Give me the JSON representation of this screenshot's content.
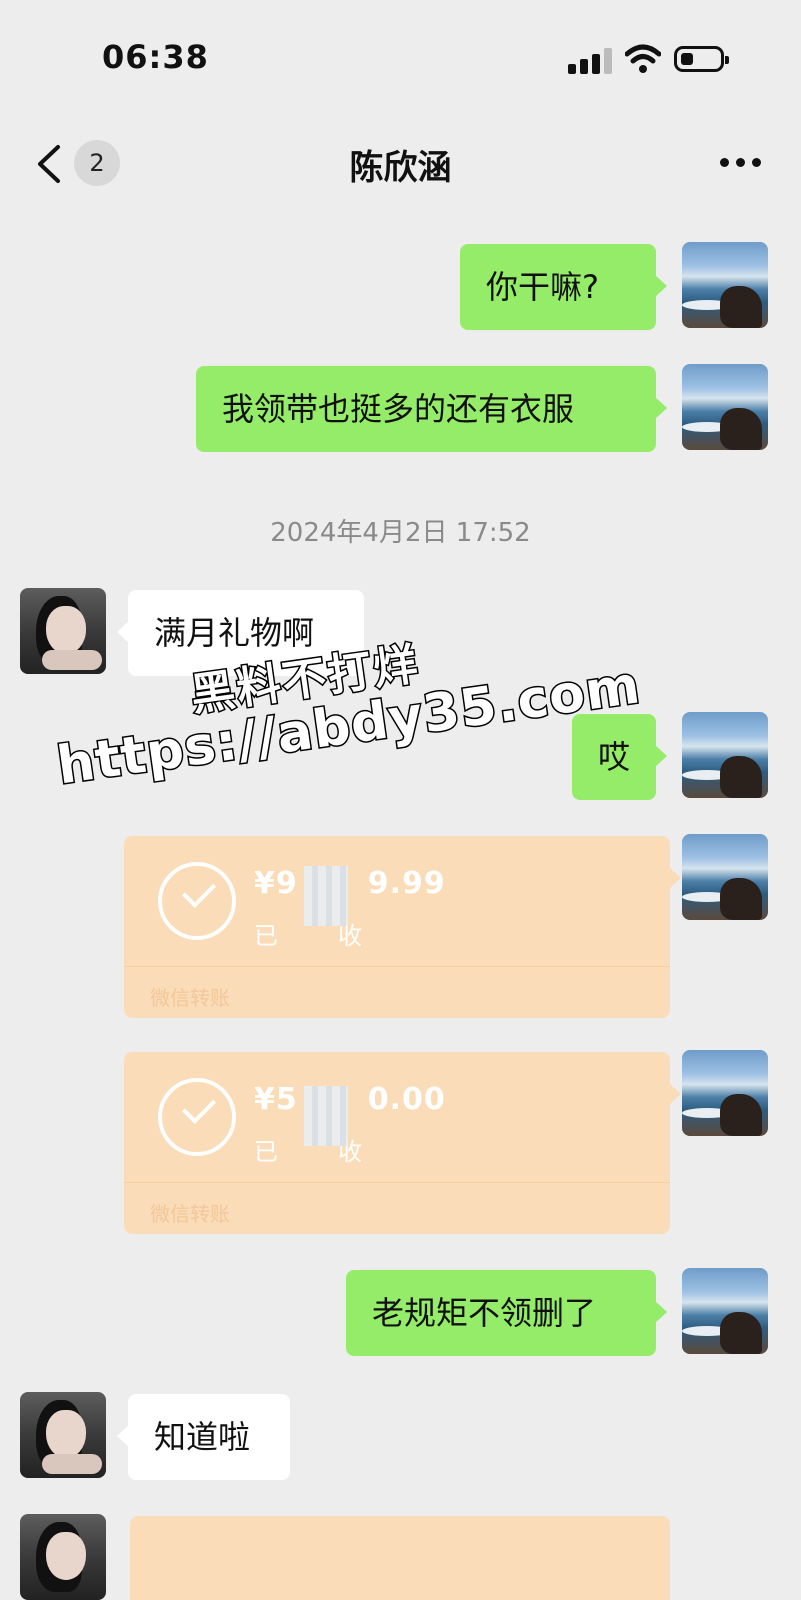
{
  "status_bar": {
    "time": "06:38"
  },
  "nav": {
    "back_count": "2",
    "title": "陈欣涵"
  },
  "messages": [
    {
      "text": "你干嘛?"
    },
    {
      "text": "我领带也挺多的还有衣服"
    },
    {
      "text": "满月礼物啊"
    },
    {
      "text": "哎"
    },
    {
      "text": "老规矩不领删了"
    },
    {
      "text": "知道啦"
    }
  ],
  "timestamp": "2024年4月2日 17:52",
  "transfers": [
    {
      "amount_left": "¥9",
      "amount_right": "9.99",
      "status_left": "已",
      "status_right": "收",
      "label": "微信转账"
    },
    {
      "amount_left": "¥5",
      "amount_right": "0.00",
      "status_left": "已",
      "status_right": "收",
      "label": "微信转账"
    }
  ],
  "watermark": {
    "line1": "黑料不打烊",
    "line2": "https://abdy35.com"
  }
}
